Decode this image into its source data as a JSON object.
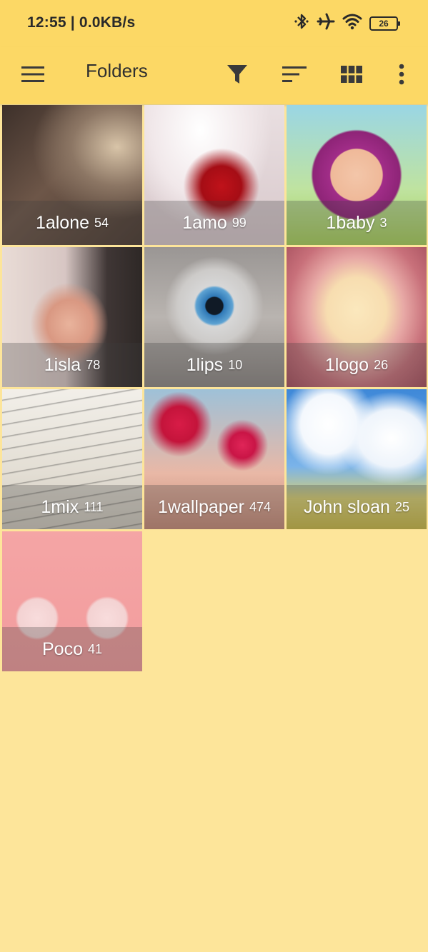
{
  "status_bar": {
    "time": "12:55",
    "speed": "0.0KB/s",
    "battery": "26",
    "icons": [
      "bluetooth-icon",
      "airplane-icon",
      "wifi-icon",
      "battery-icon"
    ]
  },
  "app_bar": {
    "title": "Folders",
    "icons": [
      "menu-icon",
      "filter-icon",
      "sort-icon",
      "grid-view-icon",
      "more-icon"
    ]
  },
  "folders": [
    {
      "name": "1alone",
      "count": "54"
    },
    {
      "name": "1amo",
      "count": "99"
    },
    {
      "name": "1baby",
      "count": "3"
    },
    {
      "name": "1isla",
      "count": "78"
    },
    {
      "name": "1lips",
      "count": "10"
    },
    {
      "name": "1logo",
      "count": "26"
    },
    {
      "name": "1mix",
      "count": "111"
    },
    {
      "name": "1wallpaper",
      "count": "474"
    },
    {
      "name": "John sloan",
      "count": "25"
    },
    {
      "name": "Poco",
      "count": "41"
    }
  ],
  "colors": {
    "background": "#FDE59A",
    "app_bar": "#FCD865",
    "icon": "#3a3a3a"
  }
}
